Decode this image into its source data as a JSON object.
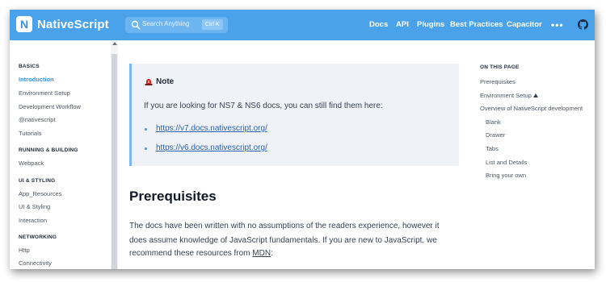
{
  "header": {
    "brand": "NativeScript",
    "logo_letter": "N",
    "search_placeholder": "Search Anything",
    "search_shortcut": "Ctrl K",
    "nav": [
      "Docs",
      "API",
      "Plugins",
      "Best Practices",
      "Capacitor"
    ],
    "more": "•••"
  },
  "sidebar": {
    "items": [
      {
        "label": "BASICS",
        "kind": "head"
      },
      {
        "label": "Introduction",
        "kind": "active"
      },
      {
        "label": "Environment Setup",
        "kind": "link"
      },
      {
        "label": "Development Workflow",
        "kind": "link"
      },
      {
        "label": "@nativescript",
        "kind": "link"
      },
      {
        "label": "Tutorials",
        "kind": "link"
      },
      {
        "label": "RUNNING & BUILDING",
        "kind": "head"
      },
      {
        "label": "Webpack",
        "kind": "link"
      },
      {
        "label": "UI & STYLING",
        "kind": "head"
      },
      {
        "label": "App_Resources",
        "kind": "link"
      },
      {
        "label": "UI & Styling",
        "kind": "link"
      },
      {
        "label": "Interaction",
        "kind": "link"
      },
      {
        "label": "NETWORKING",
        "kind": "head"
      },
      {
        "label": "Http",
        "kind": "link"
      },
      {
        "label": "Connectivity",
        "kind": "link"
      }
    ]
  },
  "note": {
    "title": "Note",
    "text": "If you are looking for NS7 & NS6 docs, you can still find them here:",
    "links": [
      "https://v7.docs.nativescript.org/",
      "https://v6.docs.nativescript.org/"
    ]
  },
  "main": {
    "heading": "Prerequisites",
    "para_line1": "The docs have been written with no assumptions of the readers experience, however it",
    "para_line2": "does assume knowledge of JavaScript fundamentals. If you are new to JavaScript, we",
    "para_line3_prefix": "recommend these resources from ",
    "para_line3_link": "MDN",
    "para_line3_suffix": ":"
  },
  "toc": {
    "title": "ON THIS PAGE",
    "items": [
      {
        "label": "Prerequisites",
        "indent": false
      },
      {
        "label": "Environment Setup",
        "indent": false,
        "warning": true
      },
      {
        "label": "Overview of NativeScript development",
        "indent": false
      },
      {
        "label": "Blank",
        "indent": true
      },
      {
        "label": "Drawer",
        "indent": true
      },
      {
        "label": "Tabs",
        "indent": true
      },
      {
        "label": "List and Details",
        "indent": true
      },
      {
        "label": "Bring your own",
        "indent": true
      }
    ]
  },
  "colors": {
    "header_bg": "#4aa3ea",
    "accent": "#3b8ee0",
    "link": "#2b5fa6",
    "note_bg": "#eff3f8"
  }
}
